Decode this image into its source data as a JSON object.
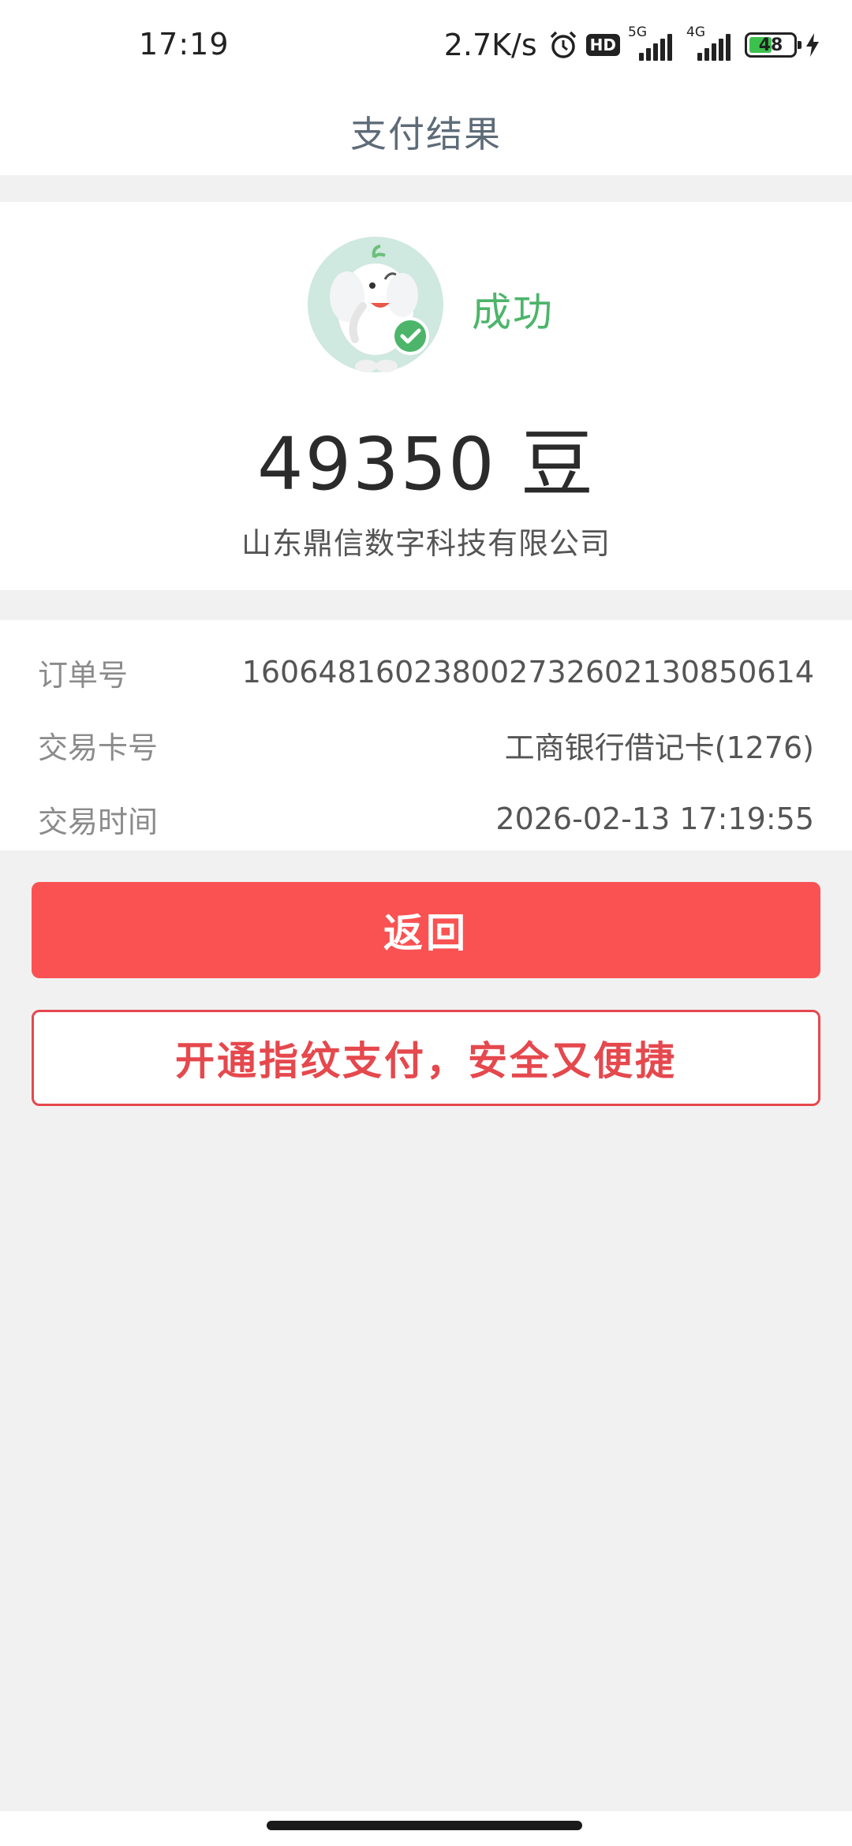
{
  "status_bar": {
    "time": "17:19",
    "net_speed": "2.7K/s",
    "hd_label": "HD",
    "sim1_label": "5G",
    "sim2_label": "4G",
    "battery_level": "48",
    "icons": [
      "alarm-icon",
      "hd-icon",
      "signal-5g-icon",
      "signal-4g-icon",
      "battery-icon",
      "charging-icon"
    ]
  },
  "header": {
    "title": "支付结果"
  },
  "result": {
    "status": "成功",
    "amount": "49350 豆",
    "merchant": "山东鼎信数字科技有限公司",
    "status_color": "#4cb56a"
  },
  "details": [
    {
      "label": "订单号",
      "value": "1606481602380027326021308506​14"
    },
    {
      "label": "交易卡号",
      "value": "工商银行借记卡(1276)"
    },
    {
      "label": "交易时间",
      "value": "2026-02-13 17:19:55"
    }
  ],
  "actions": {
    "back_label": "返回",
    "fingerprint_label": "开通指纹支付，安全又便捷",
    "primary_color": "#fa5252"
  }
}
